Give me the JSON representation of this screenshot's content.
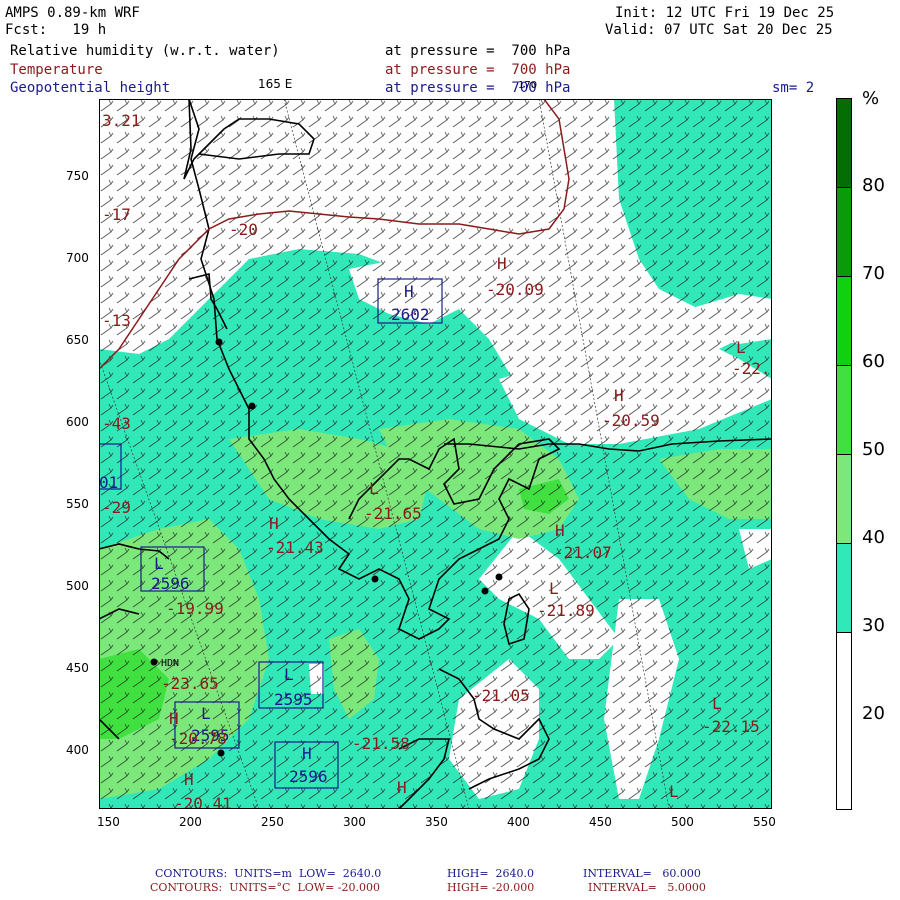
{
  "header": {
    "model": "AMPS 0.89-km WRF",
    "fcst": "Fcst:   19 h",
    "init": "Init: 12 UTC Fri 19 Dec 25",
    "valid": "Valid: 07 UTC Sat 20 Dec 25",
    "fields": [
      {
        "name": "Relative humidity (w.r.t. water)",
        "level": "at pressure =  700 hPa"
      },
      {
        "name": "Temperature",
        "level": "at pressure =  700 hPa"
      },
      {
        "name": "Geopotential height",
        "level": "at pressure =  700 hPa"
      }
    ],
    "lon_label_1": "165 E",
    "lon_label_2": "170",
    "smoothing": "sm= 2"
  },
  "axes": {
    "x_ticks": [
      "150",
      "200",
      "250",
      "300",
      "350",
      "400",
      "450",
      "500",
      "550"
    ],
    "y_ticks": [
      "750",
      "700",
      "650",
      "600",
      "550",
      "500",
      "450",
      "400"
    ]
  },
  "colorbar": {
    "unit": "%",
    "labels": [
      "80",
      "70",
      "60",
      "50",
      "40",
      "30",
      "20"
    ],
    "colors": [
      "#ffffff",
      "#30e8b8",
      "#7ce87c",
      "#40e040",
      "#10d010",
      "#0a9a0a",
      "#046d04"
    ]
  },
  "map_labels": [
    {
      "text": "-20",
      "cls": "red"
    },
    {
      "text": "H",
      "cls": "red"
    },
    {
      "text": "-20.09",
      "cls": "red"
    },
    {
      "text": "H",
      "cls": "blue"
    },
    {
      "text": "2602",
      "cls": "blue"
    },
    {
      "text": "L",
      "cls": "red"
    },
    {
      "text": "-22.",
      "cls": "red"
    },
    {
      "text": "H",
      "cls": "red"
    },
    {
      "text": "-20.59",
      "cls": "red"
    },
    {
      "text": "L",
      "cls": "red"
    },
    {
      "text": "-21.65",
      "cls": "red"
    },
    {
      "text": "H",
      "cls": "red"
    },
    {
      "text": "-21.43",
      "cls": "red"
    },
    {
      "text": "H",
      "cls": "red"
    },
    {
      "text": "-21.07",
      "cls": "red"
    },
    {
      "text": "L",
      "cls": "red"
    },
    {
      "text": "-21.89",
      "cls": "red"
    },
    {
      "text": "-21.05",
      "cls": "red"
    },
    {
      "text": "L",
      "cls": "red"
    },
    {
      "text": "-22.15",
      "cls": "red"
    },
    {
      "text": "-21.58",
      "cls": "red"
    },
    {
      "text": "L",
      "cls": "blue"
    },
    {
      "text": "2596",
      "cls": "blue"
    },
    {
      "text": "-19.99",
      "cls": "red"
    },
    {
      "text": "L",
      "cls": "blue"
    },
    {
      "text": "2595",
      "cls": "blue"
    },
    {
      "text": "-23.65",
      "cls": "red"
    },
    {
      "text": "-20.78",
      "cls": "red"
    },
    {
      "text": "L",
      "cls": "blue"
    },
    {
      "text": "2595",
      "cls": "blue"
    },
    {
      "text": "H",
      "cls": "blue"
    },
    {
      "text": "2596",
      "cls": "blue"
    },
    {
      "text": "H",
      "cls": "red"
    },
    {
      "text": "-20.41",
      "cls": "red"
    },
    {
      "text": "H",
      "cls": "red"
    },
    {
      "text": "L",
      "cls": "red"
    },
    {
      "text": "-13",
      "cls": "red"
    },
    {
      "text": "-17",
      "cls": "red"
    },
    {
      "text": "-43",
      "cls": "red"
    },
    {
      "text": "-29",
      "cls": "red"
    },
    {
      "text": "3.21",
      "cls": "red"
    },
    {
      "text": "HDN",
      "cls": "black"
    },
    {
      "text": "H",
      "cls": "red"
    },
    {
      "text": "L",
      "cls": "blue"
    },
    {
      "text": "01",
      "cls": "blue"
    }
  ],
  "footer": {
    "line1_a": "CONTOURS:  UNITS=m  LOW=  2640.0",
    "line1_b": "HIGH=  2640.0",
    "line1_c": "INTERVAL=   60.000",
    "line2_a": "CONTOURS:  UNITS=°C  LOW= -20.000",
    "line2_b": "HIGH= -20.000",
    "line2_c": "INTERVAL=   5.0000"
  }
}
